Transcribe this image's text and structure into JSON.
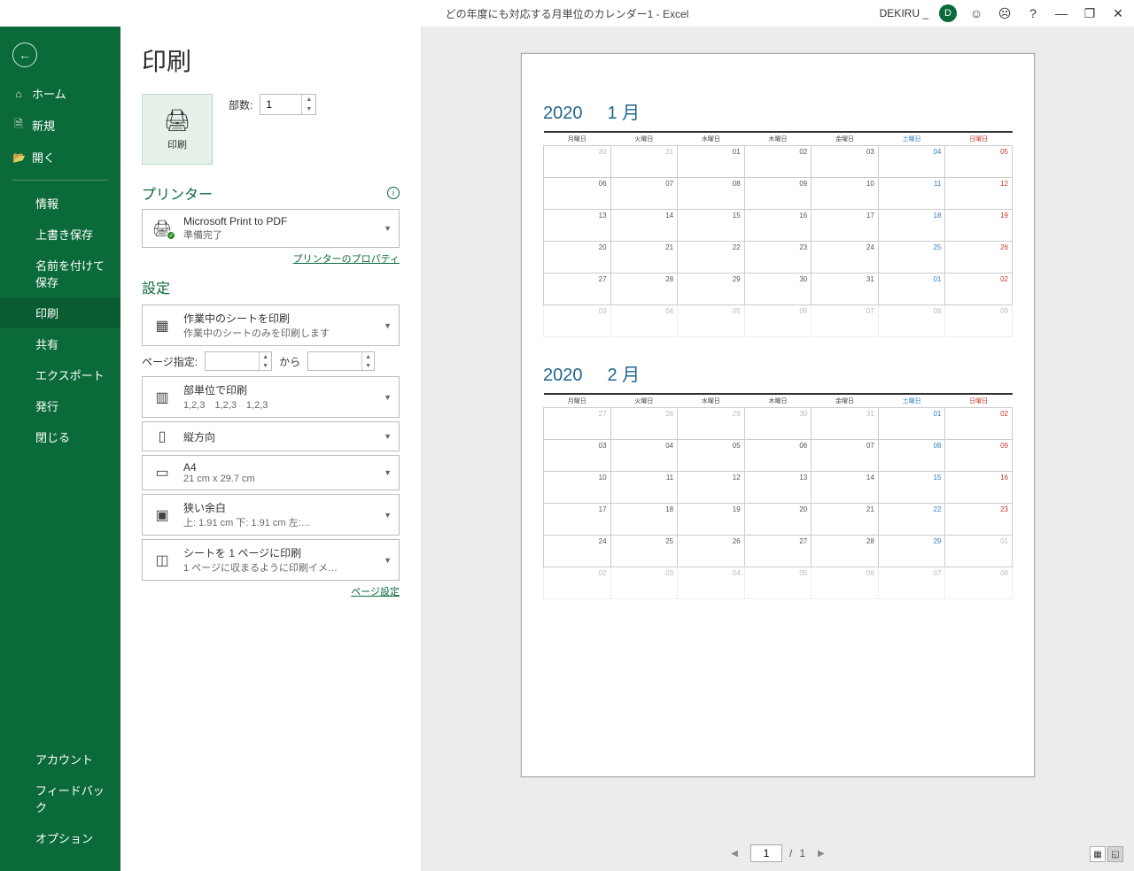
{
  "titlebar": {
    "title": "どの年度にも対応する月単位のカレンダー1  -  Excel",
    "user": "DEKIRU _",
    "avatar": "D"
  },
  "sidebar": {
    "back": "←",
    "top": [
      {
        "icon": "⌂",
        "label": "ホーム"
      },
      {
        "icon": "🗎",
        "label": "新規"
      },
      {
        "icon": "📂",
        "label": "開く"
      }
    ],
    "mid": [
      {
        "label": "情報"
      },
      {
        "label": "上書き保存"
      },
      {
        "label": "名前を付けて保存"
      },
      {
        "label": "印刷",
        "active": true
      },
      {
        "label": "共有"
      },
      {
        "label": "エクスポート"
      },
      {
        "label": "発行"
      },
      {
        "label": "閉じる"
      }
    ],
    "bottom": [
      {
        "label": "アカウント"
      },
      {
        "label": "フィードバック"
      },
      {
        "label": "オプション"
      }
    ]
  },
  "print": {
    "pageTitle": "印刷",
    "printBtn": "印刷",
    "copiesLabel": "部数:",
    "copiesValue": "1",
    "printerHeading": "プリンター",
    "printerName": "Microsoft Print to PDF",
    "printerStatus": "準備完了",
    "printerProps": "プリンターのプロパティ",
    "settingsHeading": "設定",
    "setting1": {
      "t1": "作業中のシートを印刷",
      "t2": "作業中のシートのみを印刷します"
    },
    "pageSpecLabel": "ページ指定:",
    "pageSpecFrom": "",
    "pageSpecTo": "",
    "pageSpecKara": "から",
    "setting2": {
      "t1": "部単位で印刷",
      "t2": "1,2,3　1,2,3　1,2,3"
    },
    "setting3": {
      "t1": "縦方向",
      "t2": ""
    },
    "setting4": {
      "t1": "A4",
      "t2": "21 cm x 29.7 cm"
    },
    "setting5": {
      "t1": "狭い余白",
      "t2": "上: 1.91 cm 下: 1.91 cm 左:…"
    },
    "setting6": {
      "t1": "シートを 1 ページに印刷",
      "t2": "1 ページに収まるように印刷イメ…"
    },
    "pageSetup": "ページ設定",
    "footer": {
      "current": "1",
      "of": "1",
      "sep": "/"
    }
  },
  "calendar": {
    "year": "2020",
    "months": [
      {
        "name": "1 月",
        "headers": [
          "月曜日",
          "火曜日",
          "水曜日",
          "木曜日",
          "金曜日",
          "土曜日",
          "日曜日"
        ],
        "rows": [
          [
            "30",
            "31",
            "01",
            "02",
            "03",
            "04",
            "05"
          ],
          [
            "06",
            "07",
            "08",
            "09",
            "10",
            "11",
            "12"
          ],
          [
            "13",
            "14",
            "15",
            "16",
            "17",
            "18",
            "19"
          ],
          [
            "20",
            "21",
            "22",
            "23",
            "24",
            "25",
            "26"
          ],
          [
            "27",
            "28",
            "29",
            "30",
            "31",
            "01",
            "02"
          ],
          [
            "03",
            "04",
            "05",
            "06",
            "07",
            "08",
            "09"
          ]
        ]
      },
      {
        "name": "2 月",
        "headers": [
          "月曜日",
          "火曜日",
          "水曜日",
          "木曜日",
          "金曜日",
          "土曜日",
          "日曜日"
        ],
        "rows": [
          [
            "27",
            "28",
            "29",
            "30",
            "31",
            "01",
            "02"
          ],
          [
            "03",
            "04",
            "05",
            "06",
            "07",
            "08",
            "09"
          ],
          [
            "10",
            "11",
            "12",
            "13",
            "14",
            "15",
            "16"
          ],
          [
            "17",
            "18",
            "19",
            "20",
            "21",
            "22",
            "23"
          ],
          [
            "24",
            "25",
            "26",
            "27",
            "28",
            "29",
            "01"
          ],
          [
            "02",
            "03",
            "04",
            "05",
            "06",
            "07",
            "08"
          ]
        ]
      }
    ]
  }
}
